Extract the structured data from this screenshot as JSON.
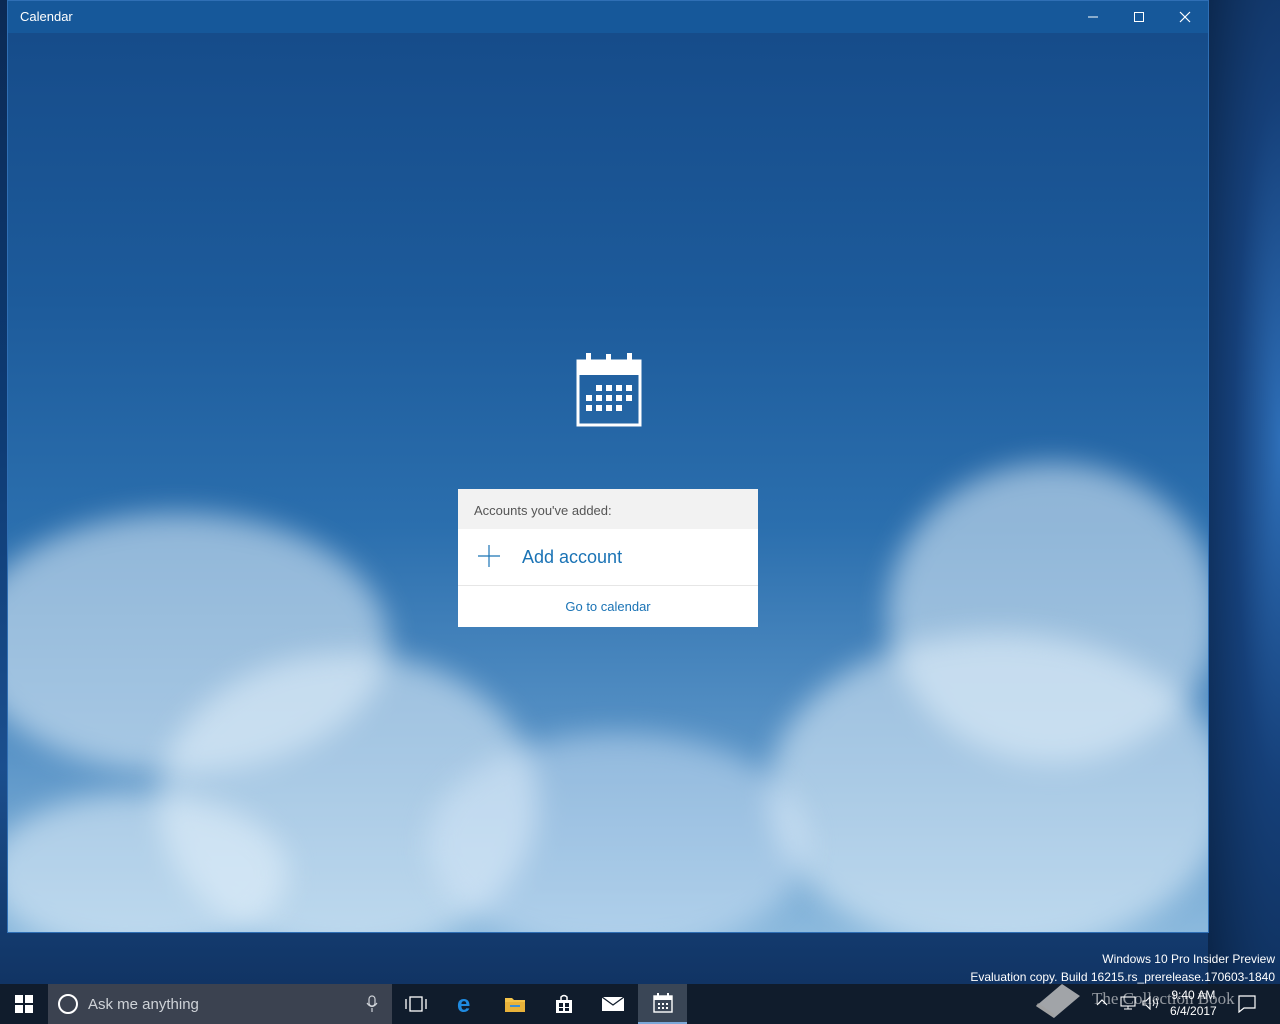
{
  "window": {
    "title": "Calendar"
  },
  "dialog": {
    "header": "Accounts you've added:",
    "add_account_label": "Add account",
    "go_to_calendar_label": "Go to calendar"
  },
  "watermark": {
    "line1": "Windows 10 Pro Insider Preview",
    "line2": "Evaluation copy. Build 16215.rs_prerelease.170603-1840"
  },
  "taskbar": {
    "search_placeholder": "Ask me anything",
    "apps": [
      "start-icon",
      "task-view-icon",
      "edge-icon",
      "file-explorer-icon",
      "store-icon",
      "mail-icon",
      "calendar-icon"
    ],
    "active_app": "calendar-icon",
    "clock_time": "9:40 AM",
    "clock_date": "6/4/2017",
    "overlay_brand": "The Collection Book"
  },
  "colors": {
    "titlebar": "#16589a",
    "accent_link": "#1a73b5",
    "taskbar": "#101c2c"
  }
}
